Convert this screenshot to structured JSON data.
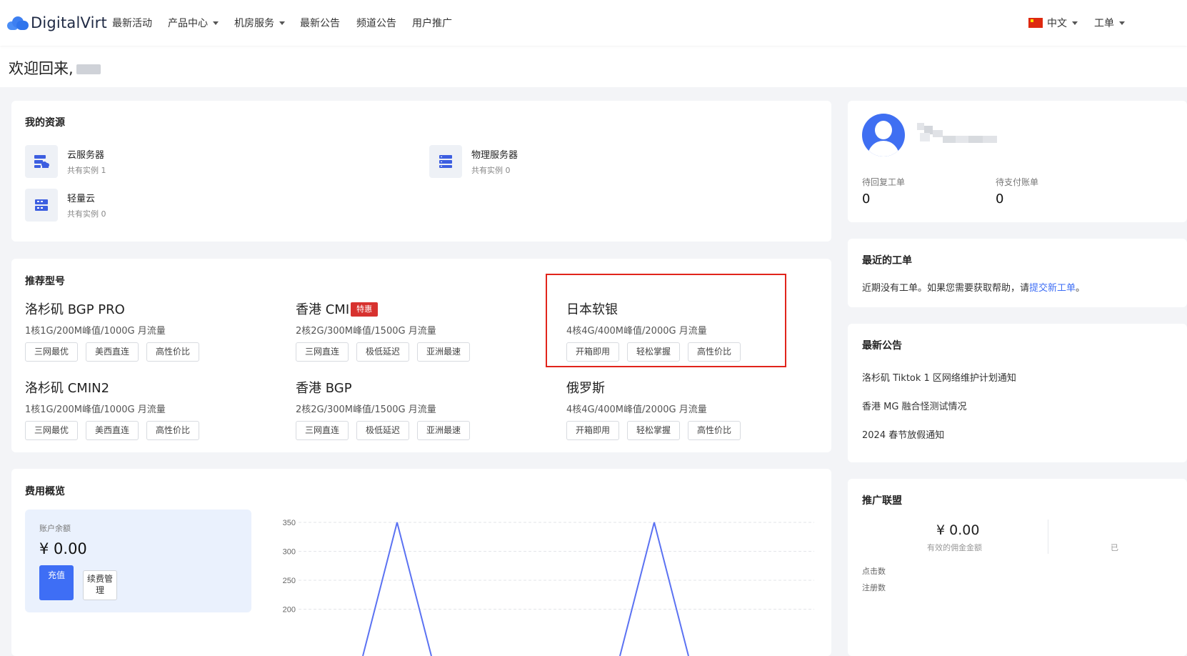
{
  "nav": {
    "brand": "DigitalVirt",
    "items": [
      "最新活动",
      "产品中心",
      "机房服务",
      "最新公告",
      "频道公告",
      "用户推广"
    ],
    "language": "中文",
    "ticket_menu": "工单"
  },
  "welcome": {
    "text": "欢迎回来,"
  },
  "resources": {
    "title": "我的资源",
    "items": [
      {
        "name": "云服务器",
        "count": "共有实例 1",
        "icon": "cloud-server-icon"
      },
      {
        "name": "物理服务器",
        "count": "共有实例 0",
        "icon": "physical-server-icon"
      },
      {
        "name": "轻量云",
        "count": "共有实例 0",
        "icon": "lightweight-cloud-icon"
      }
    ]
  },
  "products": {
    "title": "推荐型号",
    "items": [
      {
        "name": "洛杉矶 BGP PRO",
        "spec": "1核1G/200M峰值/1000G 月流量",
        "tags": [
          "三网最优",
          "美西直连",
          "高性价比"
        ]
      },
      {
        "name": "香港 CMI",
        "badge": "特惠",
        "spec": "2核2G/300M峰值/1500G 月流量",
        "tags": [
          "三网直连",
          "极低延迟",
          "亚洲最速"
        ]
      },
      {
        "name": "日本软银",
        "spec": "4核4G/400M峰值/2000G 月流量",
        "tags": [
          "开箱即用",
          "轻松掌握",
          "高性价比"
        ]
      },
      {
        "name": "洛杉矶 CMIN2",
        "spec": "1核1G/200M峰值/1000G 月流量",
        "tags": [
          "三网最优",
          "美西直连",
          "高性价比"
        ]
      },
      {
        "name": "香港 BGP",
        "spec": "2核2G/300M峰值/1500G 月流量",
        "tags": [
          "三网直连",
          "极低延迟",
          "亚洲最速"
        ]
      },
      {
        "name": "俄罗斯",
        "spec": "4核4G/400M峰值/2000G 月流量",
        "tags": [
          "开箱即用",
          "轻松掌握",
          "高性价比"
        ]
      }
    ]
  },
  "fees": {
    "title": "费用概览",
    "balance_label": "账户余额",
    "balance_value": "¥ 0.00",
    "recharge_label": "充值",
    "renew_label": "续费管理"
  },
  "chart_data": {
    "type": "line",
    "y_ticks": [
      "350",
      "300",
      "250",
      "200"
    ],
    "ylim": [
      200,
      350
    ],
    "visible_segments": [
      {
        "peak_y": 350
      },
      {
        "peak_y": 350
      }
    ],
    "color": "#5b72f2",
    "grid": true
  },
  "profile": {
    "pending_tickets_label": "待回复工单",
    "pending_tickets_value": "0",
    "unpaid_bills_label": "待支付账单",
    "unpaid_bills_value": "0"
  },
  "recent_tickets": {
    "title": "最近的工单",
    "text": "近期没有工单。如果您需要获取帮助，请",
    "link": "提交新工单",
    "suffix": "。"
  },
  "announcements": {
    "title": "最新公告",
    "items": [
      "洛杉矶 Tiktok 1 区网络维护计划通知",
      "香港 MG 融合怪测试情况",
      "2024 春节放假通知"
    ]
  },
  "affiliate": {
    "title": "推广联盟",
    "commission_value": "¥ 0.00",
    "commission_label": "有效的佣金金额",
    "cutoff_label": "已",
    "clicks_label": "点击数",
    "signups_label": "注册数"
  },
  "colors": {
    "accent": "#3e6ef5",
    "highlight": "#e1241b",
    "badge": "#d7322f",
    "chart_line": "#5b72f2"
  }
}
